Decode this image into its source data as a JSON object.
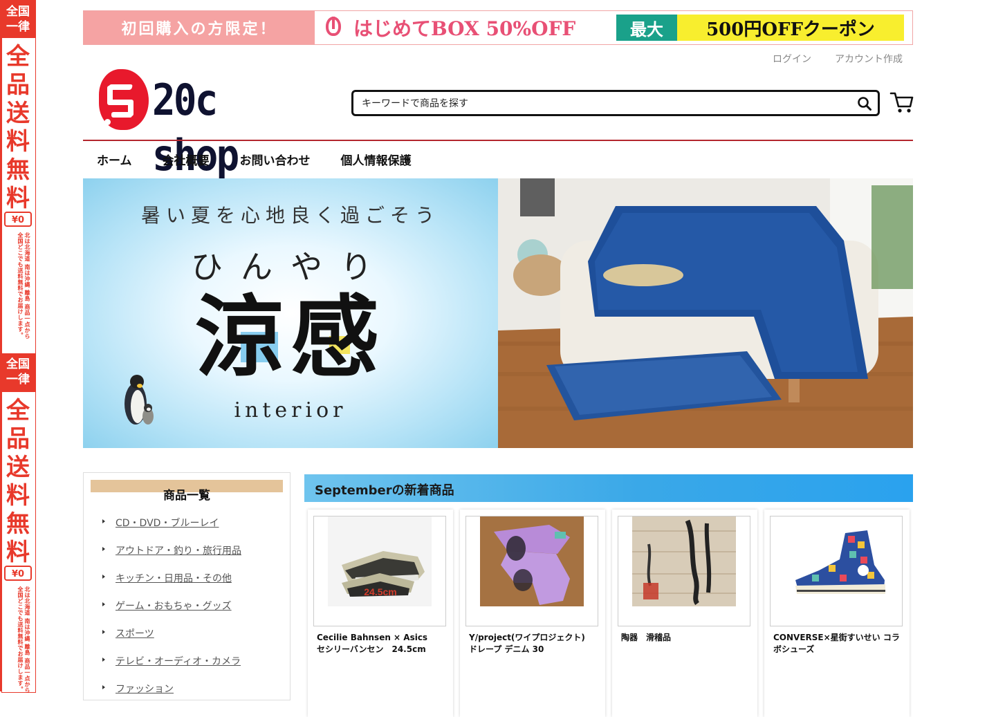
{
  "side_banner": {
    "top_label": "全国一律",
    "big_text": "全品送料無料",
    "yen_badge": "¥0",
    "note": "北は北海道 南は沖縄 離島 商品一点から全国どこでも送料無料でお届けします。"
  },
  "promo": {
    "left_text": "初回購入の方限定！",
    "box_text": "はじめてBOX 50%OFF",
    "max_label": "最大",
    "coupon_text": "500円OFFクーポン"
  },
  "account": {
    "login": "ログイン",
    "signup": "アカウント作成"
  },
  "logo": {
    "text": "20c shop"
  },
  "search": {
    "placeholder": "キーワードで商品を探す"
  },
  "nav": {
    "items": [
      "ホーム",
      "会社概要",
      "お問い合わせ",
      "個人情報保護"
    ]
  },
  "hero": {
    "subtitle": "暑い夏を心地良く過ごそう",
    "kana": "ひんやり",
    "kanji": "涼感",
    "word": "interior"
  },
  "sidebar": {
    "title": "商品一覧",
    "categories": [
      "CD・DVD・ブルーレイ",
      "アウトドア・釣り・旅行用品",
      "キッチン・日用品・その他",
      "ゲーム・おもちゃ・グッズ",
      "スポーツ",
      "テレビ・オーディオ・カメラ",
      "ファッション"
    ]
  },
  "new_arrivals": {
    "title": "Septemberの新着商品",
    "products": [
      {
        "name": "Cecilie Bahnsen × Asics　セシリーバンセン　24.5cm",
        "image_label": "24.5cm"
      },
      {
        "name": "Y/project(ワイプロジェクト) ドレープ デニム 30"
      },
      {
        "name": "陶器　滑稽品"
      },
      {
        "name": "CONVERSE×星街すいせい コラボシューズ"
      }
    ]
  },
  "colors": {
    "accent_red": "#e8392b",
    "nav_divider": "#b3262e",
    "header_blue": "#3aa8e8",
    "sidebar_head": "#e4c49a"
  }
}
